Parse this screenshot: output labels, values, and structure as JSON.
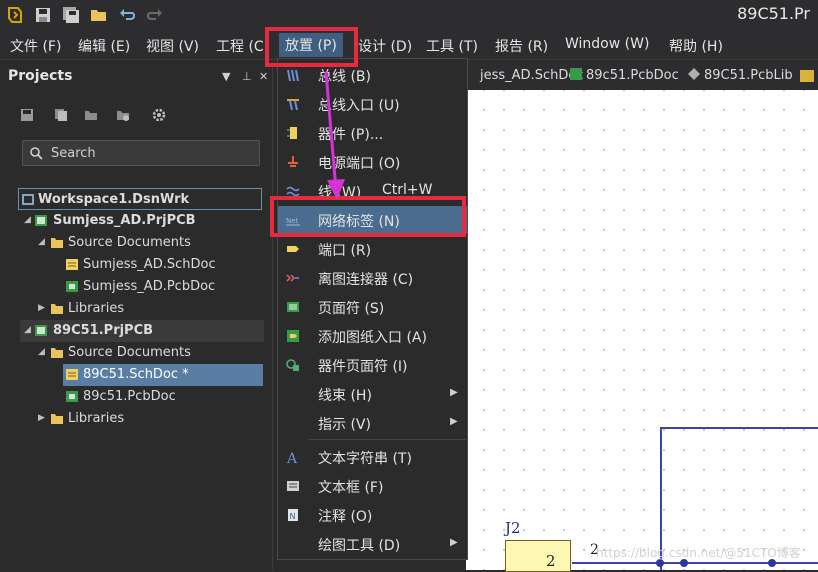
{
  "window": {
    "title": "89C51.Pr"
  },
  "menubar": {
    "items": [
      "文件 (F)",
      "编辑 (E)",
      "视图 (V)",
      "工程 (C",
      "放置 (P)",
      "设计 (D)",
      "工具 (T)",
      "报告 (R)",
      "Window (W)",
      "帮助 (H)"
    ]
  },
  "projects": {
    "title": "Projects",
    "search_placeholder": "Search",
    "tree": [
      {
        "label": "Workspace1.DsnWrk"
      },
      {
        "label": "Sumjess_AD.PrjPCB"
      },
      {
        "label": "Source Documents"
      },
      {
        "label": "Sumjess_AD.SchDoc"
      },
      {
        "label": "Sumjess_AD.PcbDoc"
      },
      {
        "label": "Libraries"
      },
      {
        "label": "89C51.PrjPCB"
      },
      {
        "label": "Source Documents"
      },
      {
        "label": "89C51.SchDoc *"
      },
      {
        "label": "89c51.PcbDoc"
      },
      {
        "label": "Libraries"
      }
    ]
  },
  "tabs": [
    "jess_AD.SchDoc",
    "89c51.PcbDoc",
    "89C51.PcbLib"
  ],
  "place_menu": {
    "items": [
      {
        "label": "总线 (B)",
        "icon": "bus-icon"
      },
      {
        "label": "总线入口 (U)",
        "icon": "bus-entry-icon"
      },
      {
        "label": "器件 (P)...",
        "icon": "part-icon"
      },
      {
        "label": "电源端口 (O)",
        "icon": "power-port-icon"
      },
      {
        "label": "线 (W)",
        "shortcut": "Ctrl+W",
        "icon": "wire-icon"
      },
      {
        "label": "网络标签 (N)",
        "icon": "net-label-icon"
      },
      {
        "label": "端口 (R)",
        "icon": "port-icon"
      },
      {
        "label": "离图连接器 (C)",
        "icon": "off-sheet-connector-icon"
      },
      {
        "label": "页面符 (S)",
        "icon": "sheet-symbol-icon"
      },
      {
        "label": "添加图纸入口 (A)",
        "icon": "sheet-entry-icon"
      },
      {
        "label": "器件页面符 (I)",
        "icon": "device-sheet-icon"
      },
      {
        "label": "线束 (H)",
        "icon": "",
        "submenu": true
      },
      {
        "label": "指示 (V)",
        "icon": "",
        "submenu": true
      },
      {
        "label": "文本字符串 (T)",
        "icon": "text-string-icon"
      },
      {
        "label": "文本框 (F)",
        "icon": "text-frame-icon"
      },
      {
        "label": "注释 (O)",
        "icon": "note-icon"
      },
      {
        "label": "绘图工具 (D)",
        "icon": "",
        "submenu": true
      }
    ]
  },
  "schematic": {
    "designator": "J2",
    "pin_number": "2",
    "pin_label": "2"
  },
  "watermark": "https://blog.csdn.net/@51CTO博客",
  "colors": {
    "accent_red": "#e52b3d",
    "highlight": "#4a6c8e",
    "arrow": "#d633d6"
  }
}
